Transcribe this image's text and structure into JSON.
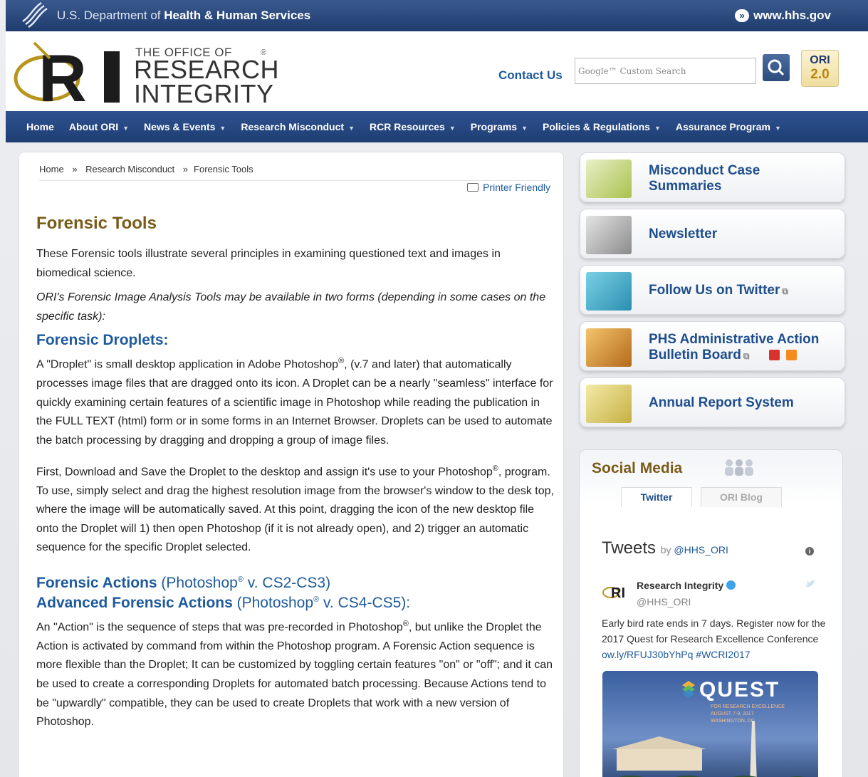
{
  "hhs_bar": {
    "dept_prefix": "U.S. Department of ",
    "dept_bold": "Health & Human Services",
    "site_link": "www.hhs.gov"
  },
  "header": {
    "logo_line1": "THE OFFICE OF",
    "logo_line2": "RESEARCH",
    "logo_line3": "INTEGRITY",
    "logo_reg": "®",
    "contact": "Contact Us",
    "search_placeholder": "Google™ Custom Search",
    "ori_badge_top": "ORI",
    "ori_badge_bottom": "2.0"
  },
  "nav": {
    "items": [
      {
        "label": "Home",
        "dropdown": false
      },
      {
        "label": "About ORI",
        "dropdown": true
      },
      {
        "label": "News & Events",
        "dropdown": true
      },
      {
        "label": "Research Misconduct",
        "dropdown": true
      },
      {
        "label": "RCR Resources",
        "dropdown": true
      },
      {
        "label": "Programs",
        "dropdown": true
      },
      {
        "label": "Policies & Regulations",
        "dropdown": true
      },
      {
        "label": "Assurance Program",
        "dropdown": true
      }
    ]
  },
  "breadcrumb": {
    "home": "Home",
    "sep1": "»",
    "section": "Research Misconduct",
    "sep2": "»",
    "current": "Forensic Tools"
  },
  "printer": "Printer Friendly",
  "article": {
    "title": "Forensic Tools",
    "intro": "These Forensic tools illustrate several principles in examining questioned text and images in biomedical science.",
    "intro2": "ORI's Forensic Image Analysis Tools may be available in two forms (depending in some cases on the specific task):",
    "droplets_heading": "Forensic Droplets:",
    "droplets_p1_a": "A \"Droplet\" is small desktop application in Adobe Photoshop",
    "droplets_p1_b": ", (v.7 and later) that automatically processes image files that are dragged onto its icon. A Droplet can be a nearly \"seamless\" interface for quickly examining certain features of a scientific image in Photoshop while reading the publication in the FULL TEXT (html) form or in some forms in an Internet Browser. Droplets can be used to automate the batch processing by dragging and dropping a group of image files.",
    "droplets_p2_a": "First, Download and Save the Droplet to the desktop and assign it's use to your Photoshop",
    "droplets_p2_b": ", program. To use, simply select and drag the highest resolution image from the browser's window to the desk top, where the image will be automatically saved. At this point, dragging the icon of the new desktop file onto the Droplet will 1) then open Photoshop (if it is not already open), and 2) trigger an automatic sequence for the specific Droplet selected.",
    "actions_heading": "Forensic Actions",
    "actions_heading_light_a": " (Photoshop",
    "actions_heading_light_b": " v. CS2-CS3)",
    "adv_heading": "Advanced Forensic Actions",
    "adv_heading_light_a": " (Photoshop",
    "adv_heading_light_b": " v. CS4-CS5):",
    "actions_p_a": "An \"Action\" is the sequence of steps that was pre-recorded in Photoshop",
    "actions_p_b": ", but unlike the Droplet the Action is activated by command from within the Photoshop program. A Forensic Action sequence is more flexible than the Droplet; It can be customized by toggling certain features \"on\" or \"off\"; and it can be used to create a corresponding Droplets for automated batch processing. Because Actions tend to be \"upwardly\" compatible, they can be used to create Droplets that work with a new version of Photoshop.",
    "reg": "®"
  },
  "sidebar": {
    "tiles": [
      {
        "label_1": "Misconduct Case",
        "label_2": "Summaries"
      },
      {
        "label_1": "Newsletter"
      },
      {
        "label_1": "Follow Us on Twitter"
      },
      {
        "label_1": "PHS Administrative Action",
        "label_2": "Bulletin Board"
      },
      {
        "label_1": "Annual Report System"
      }
    ]
  },
  "social": {
    "title": "Social Media",
    "tab_twitter": "Twitter",
    "tab_blog": "ORI Blog",
    "tweets_title": "Tweets",
    "tweets_by": "by",
    "tweets_handle": "@HHS_ORI",
    "info": "i",
    "author": "Research Integrity",
    "handle": "@HHS_ORI",
    "tweet_text": "Early bird rate ends in 7 days.  Register now for the 2017 Quest for Research Excellence Conference ",
    "tweet_link": "ow.ly/RFUJ30bYhPq",
    "tweet_tag": " #WCRI2017",
    "quest_title": "QUEST",
    "quest_sub_1": "FOR RESEARCH EXCELLENCE",
    "quest_sub_2": "AUGUST 7-9, 2017",
    "quest_sub_3": "WASHINGTON, DC"
  },
  "colors": {
    "nav_bg": "#2f5290",
    "link_blue": "#1e5a9c",
    "heading_gold": "#7a5c1a"
  }
}
